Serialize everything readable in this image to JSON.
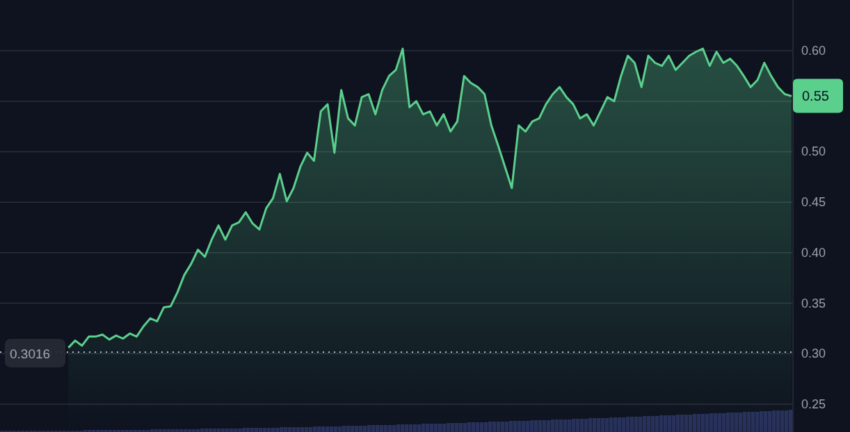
{
  "chart_data": {
    "type": "area",
    "ylim": [
      0.25,
      0.65
    ],
    "grid": true,
    "yticks": [
      {
        "value": 0.25,
        "label": "0.25"
      },
      {
        "value": 0.3,
        "label": "0.30"
      },
      {
        "value": 0.35,
        "label": "0.35"
      },
      {
        "value": 0.4,
        "label": "0.40"
      },
      {
        "value": 0.45,
        "label": "0.45"
      },
      {
        "value": 0.5,
        "label": "0.50"
      },
      {
        "value": 0.55
      },
      {
        "value": 0.6,
        "label": "0.60"
      }
    ],
    "series": [
      {
        "color": "#5bcf8c",
        "values": [
          null,
          null,
          null,
          null,
          null,
          null,
          null,
          null,
          null,
          0.306,
          0.313,
          0.308,
          0.317,
          0.317,
          0.319,
          0.314,
          0.318,
          0.315,
          0.32,
          0.317,
          0.327,
          0.335,
          0.332,
          0.346,
          0.347,
          0.361,
          0.378,
          0.389,
          0.403,
          0.396,
          0.413,
          0.427,
          0.413,
          0.427,
          0.43,
          0.44,
          0.429,
          0.423,
          0.444,
          0.454,
          0.478,
          0.451,
          0.464,
          0.485,
          0.499,
          0.491,
          0.54,
          0.547,
          0.499,
          0.561,
          0.533,
          0.526,
          0.554,
          0.557,
          0.537,
          0.561,
          0.575,
          0.581,
          0.602,
          0.544,
          0.55,
          0.537,
          0.54,
          0.526,
          0.537,
          0.52,
          0.53,
          0.575,
          0.568,
          0.564,
          0.557,
          0.526,
          0.506,
          0.485,
          0.464,
          0.526,
          0.52,
          0.53,
          0.533,
          0.547,
          0.557,
          0.564,
          0.554,
          0.547,
          0.533,
          0.537,
          0.526,
          0.54,
          0.554,
          0.55,
          0.575,
          0.595,
          0.588,
          0.564,
          0.595,
          0.588,
          0.585,
          0.595,
          0.581,
          0.588,
          0.595,
          0.599,
          0.602,
          0.585,
          0.599,
          0.588,
          0.592,
          0.585,
          0.575,
          0.564,
          0.571,
          0.588,
          0.575,
          0.564,
          0.557,
          0.555
        ]
      }
    ],
    "ref_lines": [
      {
        "axis": "y",
        "value": 0.3016,
        "label": "0.3016",
        "color": "#b8bcc6"
      }
    ]
  },
  "last_price_tag": {
    "text": "0.55"
  }
}
